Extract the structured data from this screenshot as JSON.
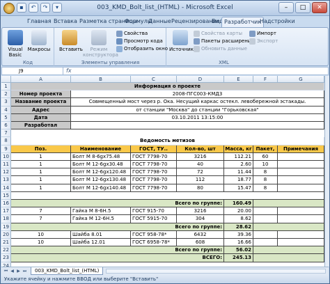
{
  "window": {
    "title": "003_KMD_Bolt_list_(HTML) - Microsoft Excel"
  },
  "tabs": [
    "Главная",
    "Вставка",
    "Разметка страницы",
    "Формулы",
    "Данные",
    "Рецензирование",
    "Вид",
    "Разработчик",
    "Надстройки"
  ],
  "active_tab": "Разработчик",
  "ribbon": {
    "visual_basic": "Visual Basic",
    "macros": "Макросы",
    "code_group": "Код",
    "insert": "Вставить",
    "design_mode": "Режим конструктора",
    "properties": "Свойства",
    "view_code": "Просмотр кода",
    "show_window": "Отобразить окно",
    "controls_group": "Элементы управления",
    "source": "Источник",
    "map_properties": "Свойства карты",
    "expansion_packs": "Пакеты расширения",
    "refresh_data": "Обновить данные",
    "import": "Импорт",
    "export": "Экспорт",
    "xml_group": "XML"
  },
  "formula_bar": {
    "name_box": "J9",
    "fx": "fx"
  },
  "columns": [
    "A",
    "B",
    "C",
    "D",
    "E",
    "F",
    "G"
  ],
  "rows": [
    "1",
    "2",
    "3",
    "4",
    "5",
    "6",
    "7",
    "8",
    "9",
    "10",
    "11",
    "12",
    "13",
    "14",
    "15",
    "16",
    "17",
    "18",
    "19",
    "20",
    "21",
    "22",
    "23",
    "24"
  ],
  "info": {
    "title": "Информация о проекте",
    "project_no_label": "Номер проекта",
    "project_no": "2008-ПГС003-КМД3",
    "project_name_label": "Название проекта",
    "project_name": "Совмещенный мост через р. Ока. Несущий каркас остекл. левобережной эстакады.",
    "address_label": "Адрес",
    "address": "от станции \"Москва\" до станции \"Горьковская\"",
    "date_label": "Дата",
    "date": "03.10.2011  13:15:00",
    "developer_label": "Разработал"
  },
  "sheet_title": "Ведомость метизов",
  "table_headers": [
    "Поз.",
    "Наименование",
    "ГОСТ, ТУ..",
    "Кол-во, шт",
    "Масса, кг",
    "Пакет,",
    "Примечания"
  ],
  "rows_data": [
    {
      "row": 10,
      "pos": "1",
      "name": "Болт М 8-6gх75.48",
      "gost": "ГОСТ 7798-70",
      "qty": "3216",
      "mass": "112.21",
      "pack": "60"
    },
    {
      "row": 11,
      "pos": "1",
      "name": "Болт М 12-6gх30.48",
      "gost": "ГОСТ 7798-70",
      "qty": "40",
      "mass": "2.60",
      "pack": "10"
    },
    {
      "row": 12,
      "pos": "1",
      "name": "Болт М 12-6gх120.48",
      "gost": "ГОСТ 7798-70",
      "qty": "72",
      "mass": "11.44",
      "pack": "8"
    },
    {
      "row": 13,
      "pos": "1",
      "name": "Болт М 12-6gх130.48",
      "gost": "ГОСТ 7798-70",
      "qty": "112",
      "mass": "18.77",
      "pack": "8"
    },
    {
      "row": 14,
      "pos": "1",
      "name": "Болт М 12-6gх140.48",
      "gost": "ГОСТ 7798-70",
      "qty": "80",
      "mass": "15.47",
      "pack": "8"
    }
  ],
  "group1_total_label": "Всего по группе:",
  "group1_total": "160.49",
  "rows_data2": [
    {
      "row": 17,
      "pos": "7",
      "name": "Гайка М 8-6Н.5",
      "gost": "ГОСТ 915-70",
      "qty": "3216",
      "mass": "20.00",
      "pack": ""
    },
    {
      "row": 18,
      "pos": "7",
      "name": "Гайка М 12-6Н.5",
      "gost": "ГОСТ 5915-70",
      "qty": "304",
      "mass": "8.62",
      "pack": ""
    }
  ],
  "group2_total_label": "Всего по группе:",
  "group2_total": "28.62",
  "rows_data3": [
    {
      "row": 20,
      "pos": "10",
      "name": "Шайба 8.01",
      "gost": "ГОСТ 958-78*",
      "qty": "6432",
      "mass": "39.36",
      "pack": ""
    },
    {
      "row": 21,
      "pos": "10",
      "name": "Шайба 12.01",
      "gost": "ГОСТ 6958-78*",
      "qty": "608",
      "mass": "16.66",
      "pack": ""
    }
  ],
  "group3_total_label": "Всего по группе:",
  "group3_total": "56.02",
  "grand_total_label": "ВСЕГО:",
  "grand_total": "245.13",
  "sheet_tab": "003_KMD_Bolt_list_(HTML)",
  "status": "Укажите ячейку и нажмите ВВОД или выберите \"Вставить\""
}
